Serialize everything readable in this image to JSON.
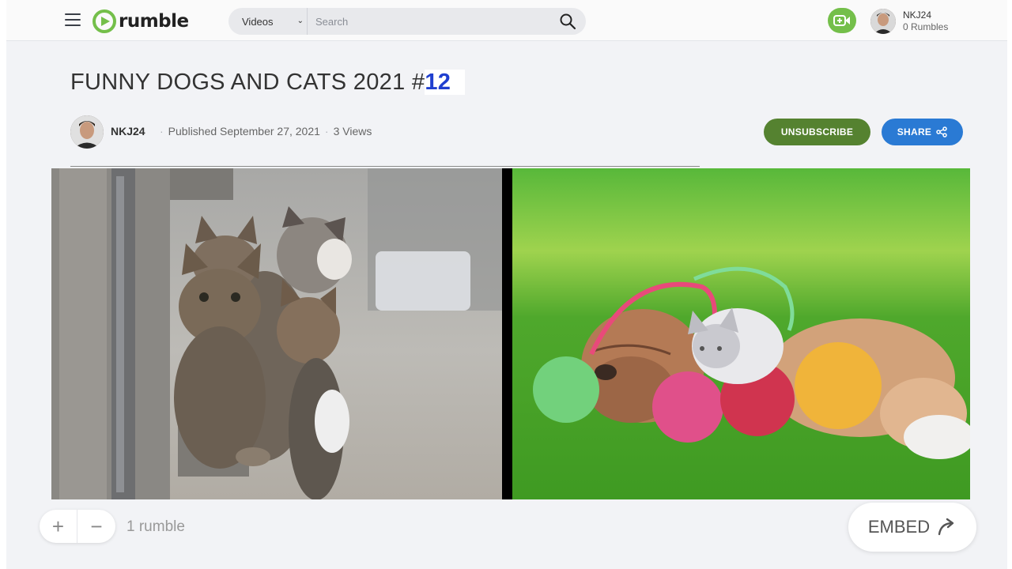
{
  "header": {
    "logo_text": "rumble",
    "search_scope": "Videos",
    "search_placeholder": "Search",
    "user_name": "NKJ24",
    "user_rumbles": "0 Rumbles",
    "icons": [
      "menu-icon",
      "rumble-logo-icon",
      "chevron-down-icon",
      "search-icon",
      "upload-video-icon",
      "avatar"
    ]
  },
  "video": {
    "title_main": "FUNNY DOGS AND CATS 2021 #",
    "title_number": "12",
    "channel": "NKJ24",
    "published": "Published September 27, 2021",
    "views": "3 Views",
    "separator": "·",
    "unsubscribe_label": "UNSUBSCRIBE",
    "share_label": "SHARE"
  },
  "actions": {
    "upvote_symbol": "+",
    "downvote_symbol": "−",
    "rumble_count": "1 rumble",
    "embed_label": "EMBED"
  },
  "colors": {
    "brand_green": "#74bf4a",
    "unsubscribe_bg": "#558230",
    "share_bg": "#2a7ad4",
    "title_number": "#1f3fcf"
  }
}
